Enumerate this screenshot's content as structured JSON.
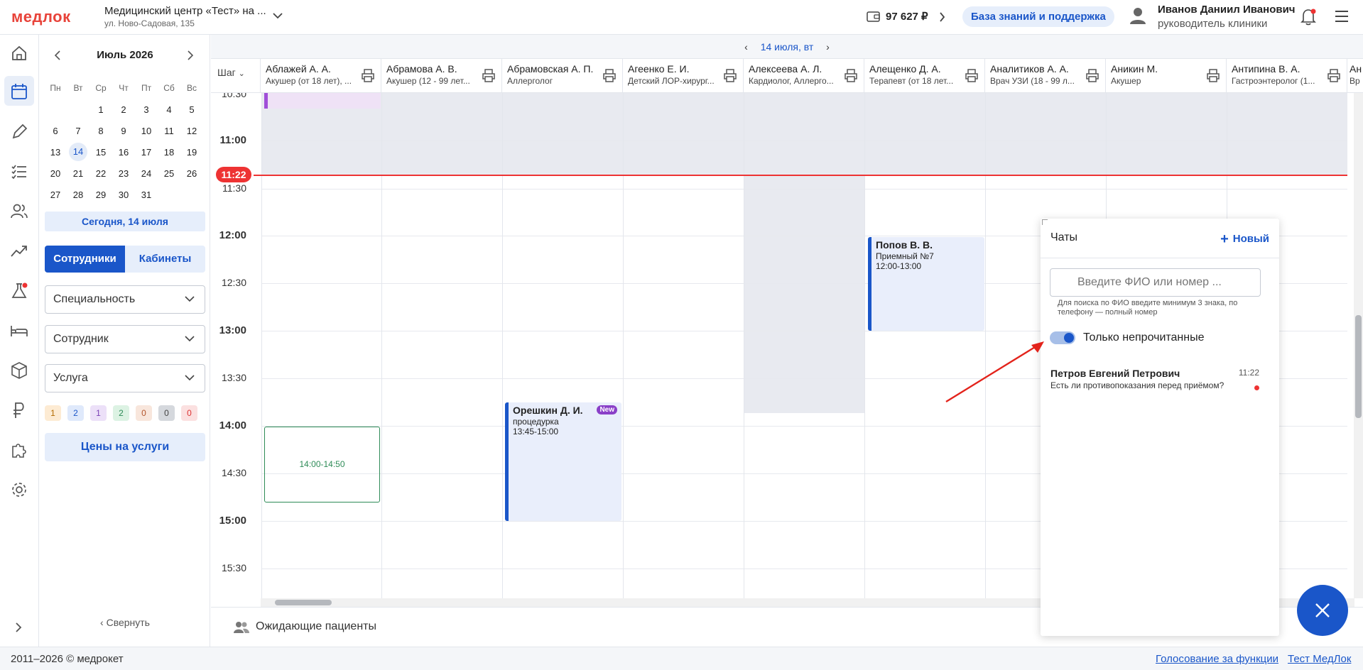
{
  "app": {
    "logo": "медлок"
  },
  "clinic": {
    "name": "Медицинский центр «Тест» на ...",
    "address": "ул. Ново-Садовая, 135"
  },
  "balance": "97 627 ₽",
  "knowledge_button": "База знаний и поддержка",
  "user": {
    "name": "Иванов Даниил Иванович",
    "role": "руководитель клиники"
  },
  "calendar": {
    "month": "Июль 2026",
    "weekdays": [
      "Пн",
      "Вт",
      "Ср",
      "Чт",
      "Пт",
      "Сб",
      "Вс"
    ],
    "weeks": [
      [
        "",
        "",
        "1",
        "2",
        "3",
        "4",
        "5"
      ],
      [
        "6",
        "7",
        "8",
        "9",
        "10",
        "11",
        "12"
      ],
      [
        "13",
        "14",
        "15",
        "16",
        "17",
        "18",
        "19"
      ],
      [
        "20",
        "21",
        "22",
        "23",
        "24",
        "25",
        "26"
      ],
      [
        "27",
        "28",
        "29",
        "30",
        "31",
        "",
        ""
      ]
    ],
    "today_day": "14",
    "today_button": "Сегодня, 14 июля"
  },
  "tabs": {
    "staff": "Сотрудники",
    "rooms": "Кабинеты"
  },
  "filters": {
    "specialty": "Специальность",
    "employee": "Сотрудник",
    "service": "Услуга"
  },
  "counters": [
    {
      "value": "1",
      "bg": "#fdebd3",
      "fg": "#b26a00"
    },
    {
      "value": "2",
      "bg": "#dfe9fb",
      "fg": "#1a56c9"
    },
    {
      "value": "1",
      "bg": "#ece0f8",
      "fg": "#7a3fb5"
    },
    {
      "value": "2",
      "bg": "#dcf2e3",
      "fg": "#2e8b57"
    },
    {
      "value": "0",
      "bg": "#f8e6dc",
      "fg": "#b2552c"
    },
    {
      "value": "0",
      "bg": "#d5d8dd",
      "fg": "#444"
    },
    {
      "value": "0",
      "bg": "#fbe0e0",
      "fg": "#d33"
    }
  ],
  "prices_button": "Цены на услуги",
  "collapse": "Свернуть",
  "schedule": {
    "date": "14 июля, вт",
    "step_label": "Шаг",
    "now": "11:22",
    "columns": [
      {
        "name": "Аблажей А. А.",
        "spec": "Акушер (от 18 лет), ..."
      },
      {
        "name": "Абрамова А. В.",
        "spec": "Акушер (12 - 99 лет..."
      },
      {
        "name": "Абрамовская А. П.",
        "spec": "Аллерголог"
      },
      {
        "name": "Агеенко Е. И.",
        "spec": "Детский ЛОР-хирург..."
      },
      {
        "name": "Алексеева А. Л.",
        "spec": "Кардиолог, Аллерго..."
      },
      {
        "name": "Алещенко Д. А.",
        "spec": "Терапевт (от 18 лет..."
      },
      {
        "name": "Аналитиков А. А.",
        "spec": "Врач УЗИ (18 - 99 л..."
      },
      {
        "name": "Аникин М.",
        "spec": "Акушер"
      },
      {
        "name": "Антипина В. А.",
        "spec": "Гастроэнтеролог (1..."
      },
      {
        "name": "Ан",
        "spec": "Вр"
      }
    ],
    "times": [
      "10:30",
      "11:00",
      "11:30",
      "12:00",
      "12:30",
      "13:00",
      "13:30",
      "14:00",
      "14:30",
      "15:00",
      "15:30"
    ],
    "appointments": {
      "popov": {
        "name": "Попов В. В.",
        "room": "Приемный №7",
        "time": "12:00-13:00"
      },
      "oreshkin": {
        "name": "Орешкин Д. И.",
        "badge": "New",
        "service": "процедурка",
        "time": "13:45-15:00"
      },
      "slot": {
        "time": "14:00-14:50"
      }
    }
  },
  "waiting": "Ожидающие пациенты",
  "footer": {
    "copyright": "2011–2026 © медрокет",
    "vote": "Голосование за функции",
    "test": "Тест МедЛок"
  },
  "chat": {
    "title": "Чаты",
    "new_label": "Новый",
    "search_placeholder": "Введите ФИО или номер ...",
    "hint": "Для поиска по ФИО введите минимум 3 знака, по телефону — полный номер",
    "unread_label": "Только непрочитанные",
    "items": [
      {
        "name": "Петров Евгений Петрович",
        "time": "11:22",
        "message": "Есть ли противопоказания перед приёмом?"
      }
    ]
  }
}
